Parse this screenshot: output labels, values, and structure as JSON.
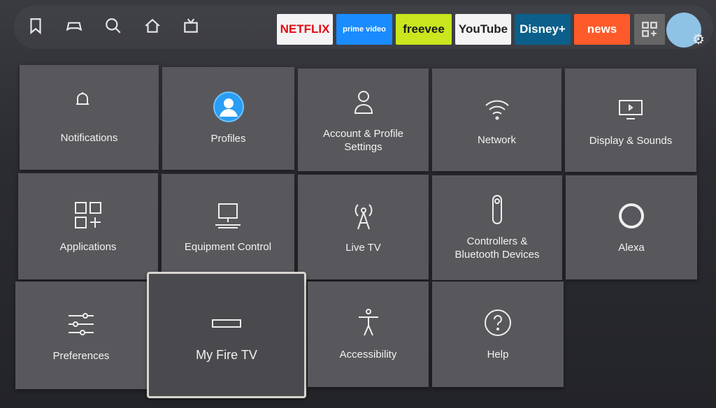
{
  "nav": {
    "icons": [
      "bookmark-icon",
      "game-controller-icon",
      "search-icon",
      "home-icon",
      "live-tv-icon"
    ]
  },
  "apps": [
    {
      "label": "NETFLIX",
      "bg": "#f4f4f4",
      "color": "#e50914"
    },
    {
      "label": "prime video",
      "bg": "#1a8cff",
      "color": "#ffffff"
    },
    {
      "label": "freevee",
      "bg": "#c9e61e",
      "color": "#1a1a1a"
    },
    {
      "label": "YouTube",
      "bg": "#f4f4f4",
      "color": "#222222"
    },
    {
      "label": "Disney+",
      "bg": "#0b5f8a",
      "color": "#ffffff"
    },
    {
      "label": "news",
      "bg": "#ff5a2a",
      "color": "#ffffff"
    }
  ],
  "tiles": [
    {
      "label": "Notifications",
      "icon": "bell-icon"
    },
    {
      "label": "Profiles",
      "icon": "profile-avatar-icon"
    },
    {
      "label": "Account & Profile Settings",
      "icon": "person-icon"
    },
    {
      "label": "Network",
      "icon": "wifi-icon"
    },
    {
      "label": "Display & Sounds",
      "icon": "display-icon"
    },
    {
      "label": "Applications",
      "icon": "apps-grid-icon"
    },
    {
      "label": "Equipment Control",
      "icon": "equipment-icon"
    },
    {
      "label": "Live TV",
      "icon": "antenna-icon"
    },
    {
      "label": "Controllers & Bluetooth Devices",
      "icon": "remote-icon"
    },
    {
      "label": "Alexa",
      "icon": "alexa-icon"
    },
    {
      "label": "Preferences",
      "icon": "sliders-icon"
    },
    {
      "label": "My Fire TV",
      "icon": "fire-tv-icon"
    },
    {
      "label": "Accessibility",
      "icon": "accessibility-icon"
    },
    {
      "label": "Help",
      "icon": "help-icon"
    }
  ],
  "focused": "My Fire TV"
}
